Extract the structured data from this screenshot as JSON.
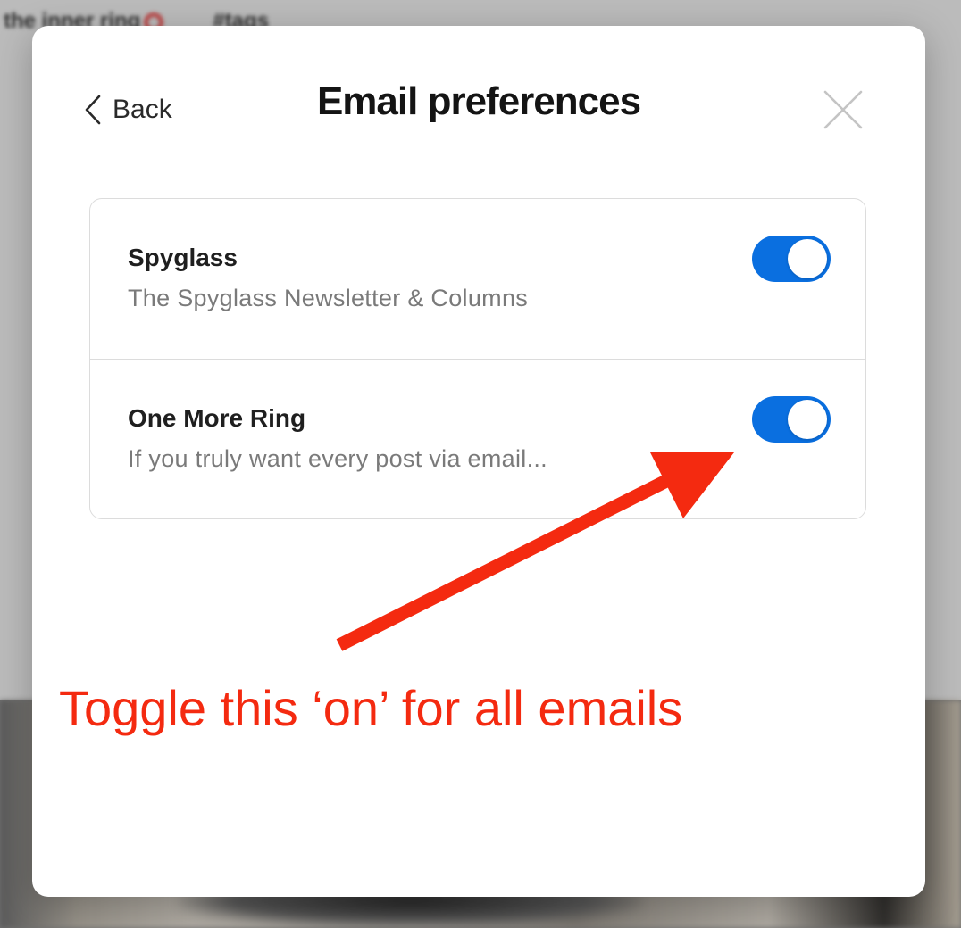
{
  "background": {
    "nav_items": [
      "the inner ring",
      "#tags"
    ]
  },
  "modal": {
    "back_label": "Back",
    "title": "Email preferences",
    "close_icon": "close-icon",
    "back_icon": "chevron-left-icon"
  },
  "preferences": [
    {
      "name": "Spyglass",
      "description": "The Spyglass Newsletter & Columns",
      "enabled": true
    },
    {
      "name": "One More Ring",
      "description": "If you truly want every post via email...",
      "enabled": true
    }
  ],
  "annotation": {
    "text": "Toggle this ‘on’ for all emails",
    "color": "#f42a10"
  },
  "colors": {
    "toggle_on": "#0a6fe0",
    "title": "#141414",
    "description": "#7a7a7a"
  }
}
